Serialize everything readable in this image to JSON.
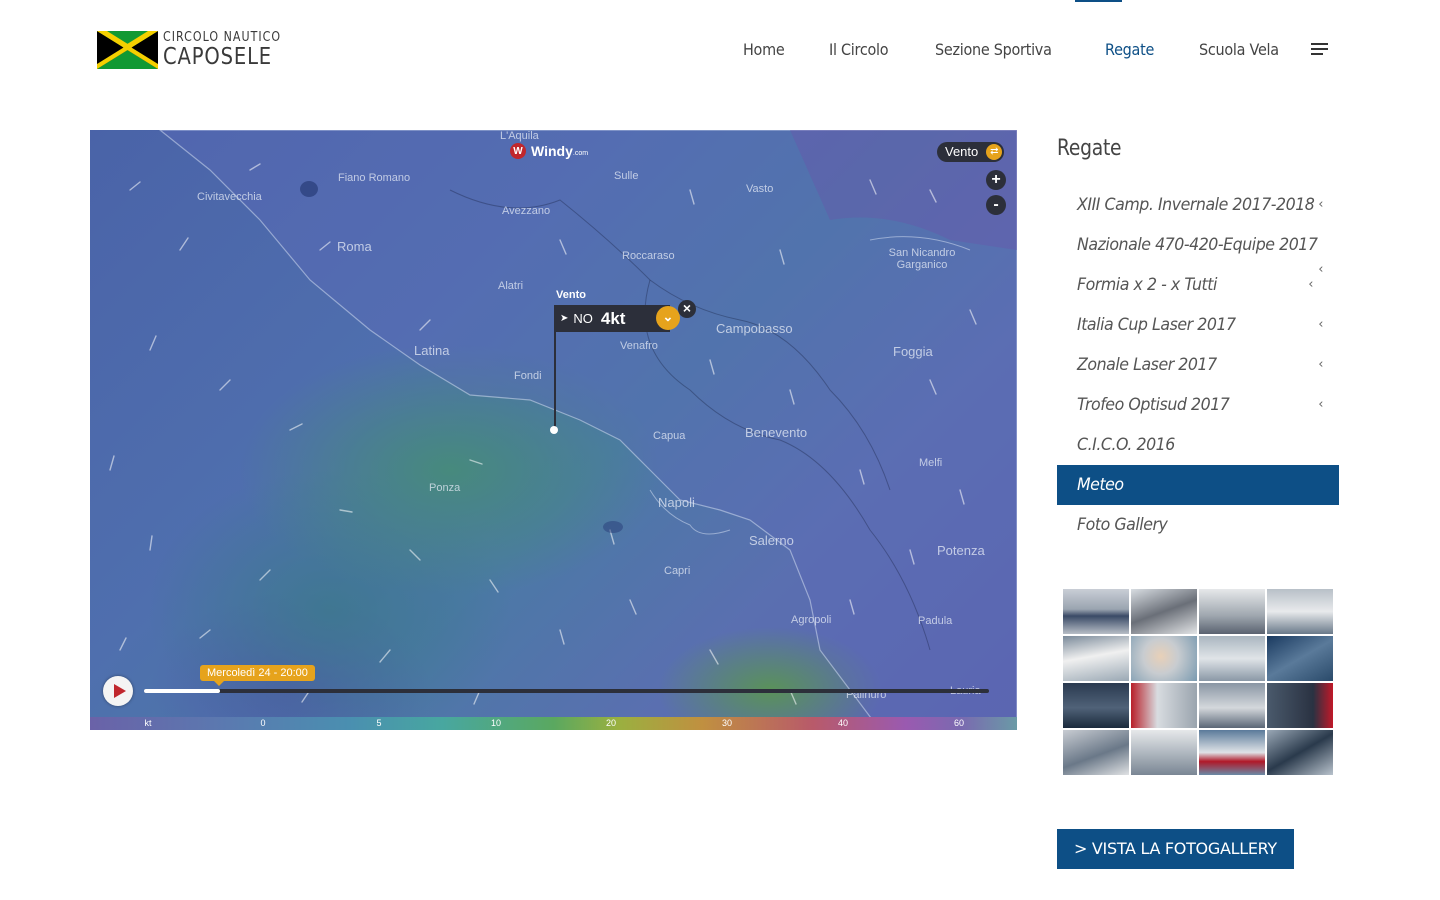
{
  "logo": {
    "line1": "CIRCOLO NAUTICO",
    "line2": "CAPOSELE",
    "flag_colors": [
      "#119933",
      "#f5d000",
      "#000000"
    ]
  },
  "nav": {
    "items": [
      {
        "label": "Home"
      },
      {
        "label": "Il Circolo"
      },
      {
        "label": "Sezione Sportiva"
      },
      {
        "label": "Regate",
        "active": true
      },
      {
        "label": "Scuola Vela"
      }
    ],
    "menu_icon": "hamburger-icon"
  },
  "map": {
    "brand": "Windy",
    "brand_domain": ".com",
    "layer_label": "Vento",
    "zoom_in": "+",
    "zoom_out": "-",
    "places": [
      {
        "name": "L'Aquila"
      },
      {
        "name": "Civitavecchia"
      },
      {
        "name": "Fiano Romano"
      },
      {
        "name": "Sulle"
      },
      {
        "name": "Vasto"
      },
      {
        "name": "Avezzano"
      },
      {
        "name": "Roma"
      },
      {
        "name": "Roccaraso"
      },
      {
        "name": "San Nicandro Garganico"
      },
      {
        "name": "Alatri"
      },
      {
        "name": "Latina"
      },
      {
        "name": "Campobasso"
      },
      {
        "name": "Venafro"
      },
      {
        "name": "Foggia"
      },
      {
        "name": "Fondi"
      },
      {
        "name": "Capua"
      },
      {
        "name": "Benevento"
      },
      {
        "name": "Melfi"
      },
      {
        "name": "Ponza"
      },
      {
        "name": "Napoli"
      },
      {
        "name": "Salerno"
      },
      {
        "name": "Potenza"
      },
      {
        "name": "Capri"
      },
      {
        "name": "Agropoli"
      },
      {
        "name": "Padula"
      },
      {
        "name": "Palinuro"
      },
      {
        "name": "Lauria"
      }
    ],
    "tooltip": {
      "label": "Vento",
      "direction": "NO",
      "value": "4kt"
    },
    "timeline": {
      "label": "Mercoledì 24 - 20:00",
      "progress": 0.09
    },
    "scale": {
      "unit": "kt",
      "ticks": [
        "0",
        "5",
        "10",
        "20",
        "30",
        "40",
        "60"
      ]
    }
  },
  "sidebar": {
    "title": "Regate",
    "items": [
      {
        "label": "XIII Camp. Invernale 2017-2018",
        "has_sub": true
      },
      {
        "label": "Nazionale 470-420-Equipe 2017",
        "has_sub": false
      },
      {
        "label": "Formia x 2 - x Tutti",
        "has_sub": true
      },
      {
        "label": "Italia Cup Laser 2017",
        "has_sub": true
      },
      {
        "label": "Zonale Laser 2017",
        "has_sub": true
      },
      {
        "label": "Trofeo Optisud 2017",
        "has_sub": true
      },
      {
        "label": "C.I.C.O. 2016",
        "has_sub": false
      },
      {
        "label": "Meteo",
        "active": true
      },
      {
        "label": "Foto Gallery",
        "has_sub": false
      }
    ],
    "gallery_button": "> VISTA LA FOTOGALLERY"
  },
  "colors": {
    "accent": "#0d4f86",
    "windy_orange": "#e6a31c",
    "windy_red": "#c0272d"
  }
}
